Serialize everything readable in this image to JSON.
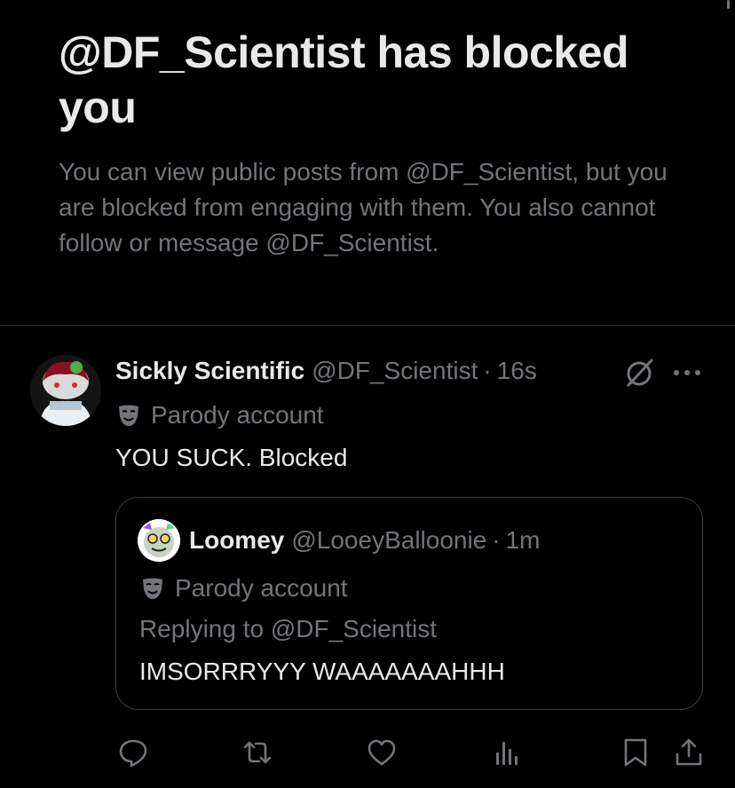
{
  "blocked_notice": {
    "title": "@DF_Scientist has blocked you",
    "description": "You can view public posts from @DF_Scientist, but you are blocked from engaging with them. You also cannot follow or message @DF_Scientist."
  },
  "post": {
    "display_name": "Sickly Scientific",
    "handle": "@DF_Scientist",
    "separator": "·",
    "time": "16s",
    "parody_label": "Parody account",
    "text": "YOU SUCK. Blocked",
    "icons": {
      "avatar": "avatar-image",
      "grok": "grok-icon",
      "more": "more-icon",
      "parody": "mask-icon"
    }
  },
  "quote": {
    "display_name": "Loomey",
    "handle": "@LooeyBalloonie",
    "separator": "·",
    "time": "1m",
    "parody_label": "Parody account",
    "replying_to": "Replying to @DF_Scientist",
    "text": "IMSORRRYYY WAAAAAAAHHH"
  },
  "actions": [
    {
      "name": "reply-icon"
    },
    {
      "name": "repost-icon"
    },
    {
      "name": "like-icon"
    },
    {
      "name": "views-icon"
    },
    {
      "name": "bookmark-icon"
    },
    {
      "name": "share-icon"
    }
  ],
  "colors": {
    "background": "#000000",
    "primary_text": "#e7e9ea",
    "secondary_text": "#71767b",
    "border": "#2f3336"
  }
}
